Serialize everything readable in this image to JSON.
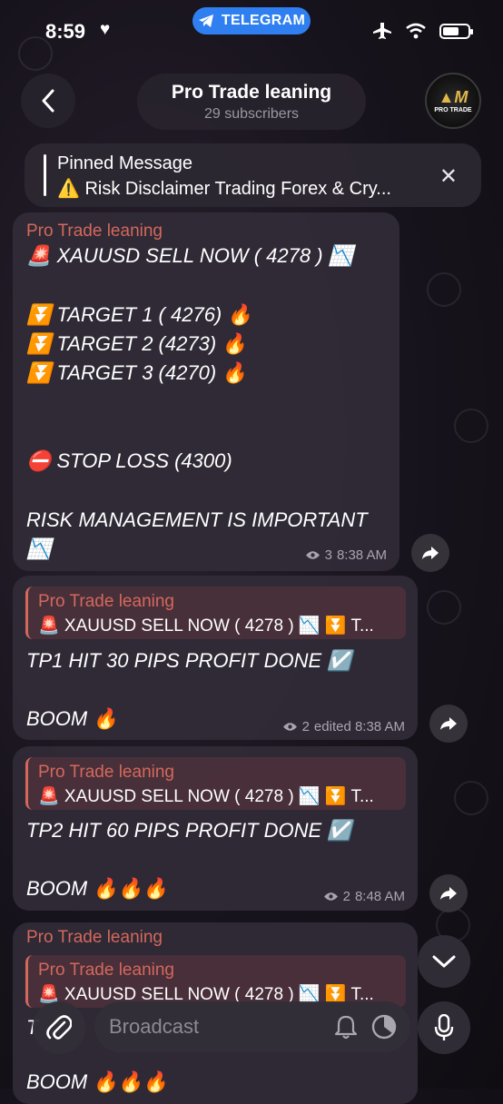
{
  "status_bar": {
    "time": "8:59",
    "app_pill": "TELEGRAM"
  },
  "header": {
    "channel_name": "Pro Trade leaning",
    "subscribers": "29 subscribers",
    "avatar_text": "PRO TRADE"
  },
  "pinned": {
    "title": "Pinned Message",
    "text": "⚠️ Risk Disclaimer Trading Forex & Cry..."
  },
  "messages": [
    {
      "sender": "Pro Trade leaning",
      "lines": [
        "🚨 XAUUSD SELL NOW  ( 4278 ) 📉",
        "⏬ TARGET 1   ( 4276) 🔥",
        "⏬ TARGET 2  (4273)  🔥",
        "⏬ TARGET 3  (4270)  🔥",
        "⛔ STOP LOSS   (4300)",
        "RISK MANAGEMENT IS IMPORTANT",
        "📉"
      ],
      "views": "3",
      "time": "8:38 AM"
    },
    {
      "reply_sender": "Pro Trade leaning",
      "reply_text": "🚨 XAUUSD SELL NOW ( 4278 ) 📉 ⏬ T...",
      "lines": [
        "TP1  HIT 30 PIPS PROFIT DONE ☑️",
        "BOOM 🔥"
      ],
      "views": "2",
      "time": "edited 8:38 AM"
    },
    {
      "reply_sender": "Pro Trade leaning",
      "reply_text": "🚨 XAUUSD SELL NOW ( 4278 ) 📉 ⏬ T...",
      "lines": [
        "TP2 HIT 60 PIPS PROFIT DONE ☑️",
        "BOOM 🔥🔥🔥"
      ],
      "views": "2",
      "time": "8:48 AM"
    },
    {
      "sender": "Pro Trade leaning",
      "reply_sender": "Pro Trade leaning",
      "reply_text": "🚨 XAUUSD SELL NOW ( 4278 ) 📉 ⏬ T...",
      "lines": [
        "T",
        "BOOM 🔥🔥🔥"
      ]
    }
  ],
  "composer": {
    "placeholder": "Broadcast"
  },
  "colors": {
    "accent": "#2f7ff0",
    "sender": "#d4685c",
    "bubble": "#302b36"
  }
}
